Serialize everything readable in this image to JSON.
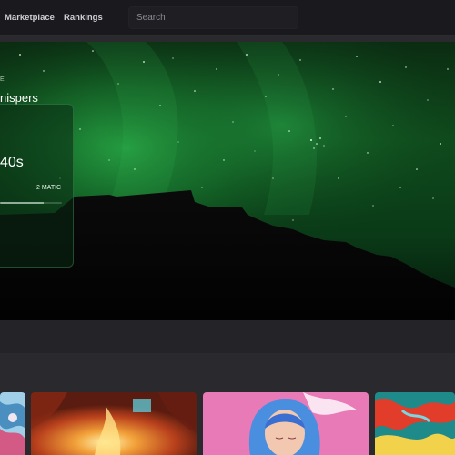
{
  "header": {
    "nav": [
      {
        "label": "Marketplace"
      },
      {
        "label": "Rankings"
      }
    ],
    "search": {
      "placeholder": "Search",
      "value": ""
    }
  },
  "hero": {
    "card": {
      "top_text": "E",
      "title": "nispers",
      "countdown": "40s",
      "price": "2 MATIC",
      "progress_fraction": 0.7
    }
  },
  "gallery": {
    "thumbnails": [
      {
        "icon": "abstract-artwork-icon"
      },
      {
        "icon": "fire-artwork-icon"
      },
      {
        "icon": "portrait-artwork-icon"
      },
      {
        "icon": "fluid-artwork-icon"
      }
    ]
  },
  "colors": {
    "page_bg": "#2a292d",
    "header_bg": "#1a191d",
    "aurora_green": "#1f9a3c",
    "text": "#ffffff"
  }
}
